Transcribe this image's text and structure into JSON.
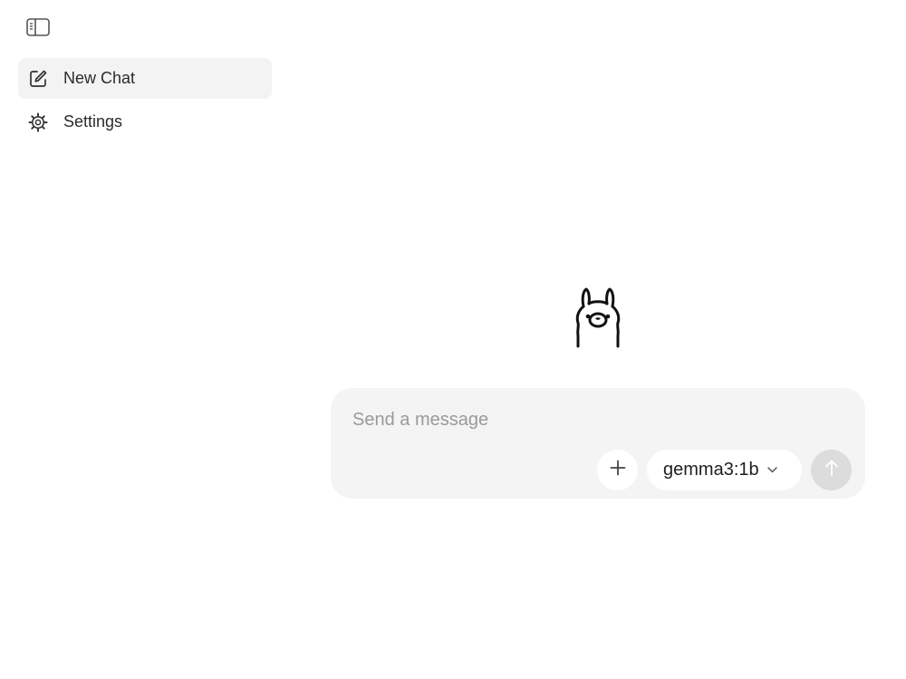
{
  "sidebar": {
    "toggle_icon": "sidebar-toggle-icon",
    "items": [
      {
        "label": "New Chat",
        "icon": "new-chat-icon",
        "active": true
      },
      {
        "label": "Settings",
        "icon": "settings-gear-icon",
        "active": false
      }
    ]
  },
  "main": {
    "mascot_icon": "llama-mascot-icon",
    "composer": {
      "placeholder": "Send a message",
      "value": "",
      "attach_icon": "plus-icon",
      "model": "gemma3:1b",
      "model_dropdown_icon": "chevron-down-icon",
      "send_icon": "arrow-up-icon",
      "send_enabled": false
    }
  },
  "colors": {
    "background": "#ffffff",
    "active_nav_bg": "#f3f3f3",
    "composer_bg": "#f4f4f4",
    "send_disabled_bg": "#dcdcdc",
    "placeholder": "#9a9a9a"
  }
}
